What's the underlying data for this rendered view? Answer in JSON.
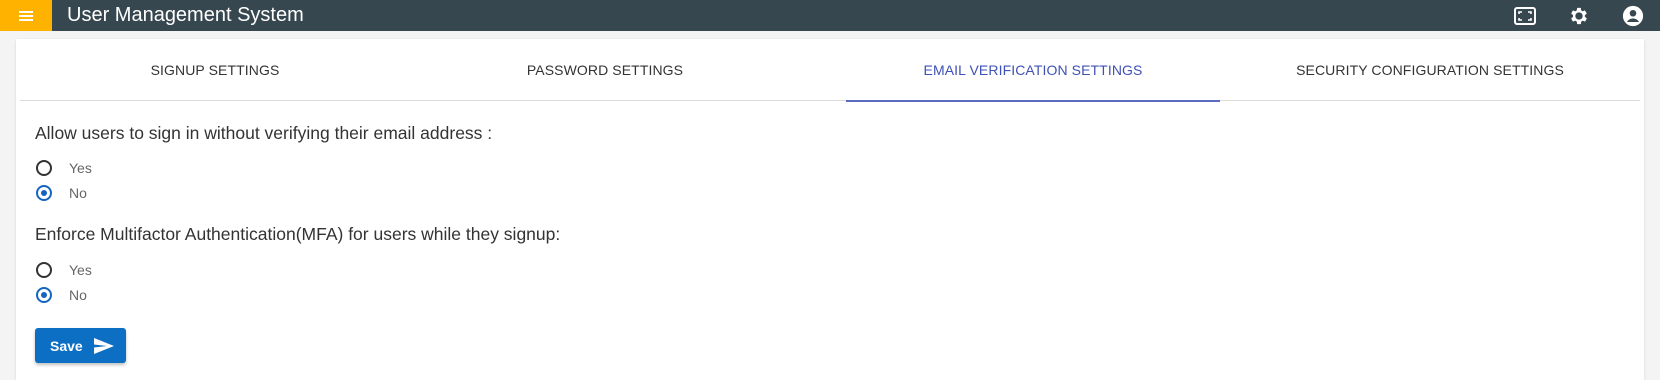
{
  "app": {
    "title": "User Management System"
  },
  "header": {
    "icons": [
      "menu-icon",
      "fullscreen-icon",
      "settings-icon",
      "account-icon"
    ],
    "menu_accent": "#ffb300",
    "bar_color": "#37474f"
  },
  "tabs": [
    {
      "label": "SIGNUP SETTINGS",
      "active": false
    },
    {
      "label": "PASSWORD SETTINGS",
      "active": false
    },
    {
      "label": "EMAIL VERIFICATION SETTINGS",
      "active": true
    },
    {
      "label": "SECURITY CONFIGURATION SETTINGS",
      "active": false
    }
  ],
  "form": {
    "email_verification": {
      "question": "Allow users to sign in without verifying their email address :",
      "options": [
        {
          "label": "Yes",
          "selected": false
        },
        {
          "label": "No",
          "selected": true
        }
      ]
    },
    "mfa": {
      "question": "Enforce Multifactor Authentication(MFA) for users while they signup:",
      "options": [
        {
          "label": "Yes",
          "selected": false
        },
        {
          "label": "No",
          "selected": true
        }
      ]
    },
    "save_label": "Save",
    "save_icon": "send-icon"
  },
  "colors": {
    "accent": "#3f51b5",
    "primary_button": "#0d6fc4",
    "radio_checked": "#1565c0"
  }
}
